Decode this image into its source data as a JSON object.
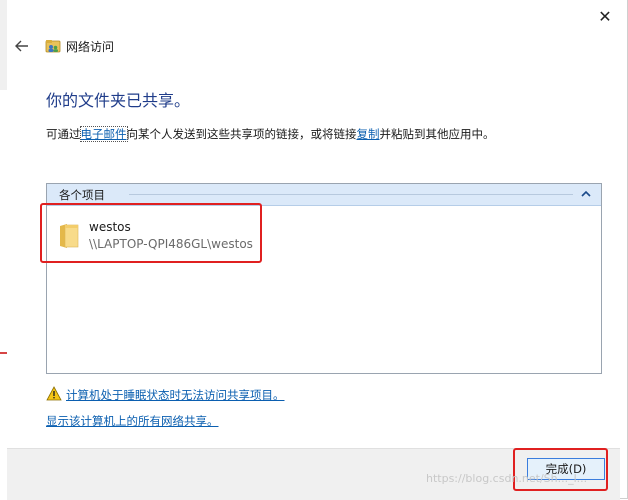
{
  "window": {
    "title": "网络访问",
    "close_glyph": "✕"
  },
  "heading": "你的文件夹已共享。",
  "description": {
    "part1": "可通过",
    "link_email": "电子邮件",
    "part2": "向某个人发送到这些共享项的链接，或将链接",
    "link_copy": "复制",
    "part3": "并粘贴到其他应用中。"
  },
  "list": {
    "group_label": "各个项目",
    "items": [
      {
        "name": "westos",
        "path": "\\\\LAPTOP-QPI486GL\\westos"
      }
    ]
  },
  "links": {
    "sleep_warning": "计算机处于睡眠状态时无法访问共享项目。",
    "show_all_shares": "显示该计算机上的所有网络共享。"
  },
  "footer": {
    "finish_label": "完成(D)"
  },
  "watermark": "https://blog.csdn.net/Sh..._l...",
  "colors": {
    "heading": "#1f3c8a",
    "link": "#0b5fb0",
    "group_header_bg": "#dbe9f9",
    "annotation_red": "#e02020",
    "button_border": "#3b7ddd"
  }
}
